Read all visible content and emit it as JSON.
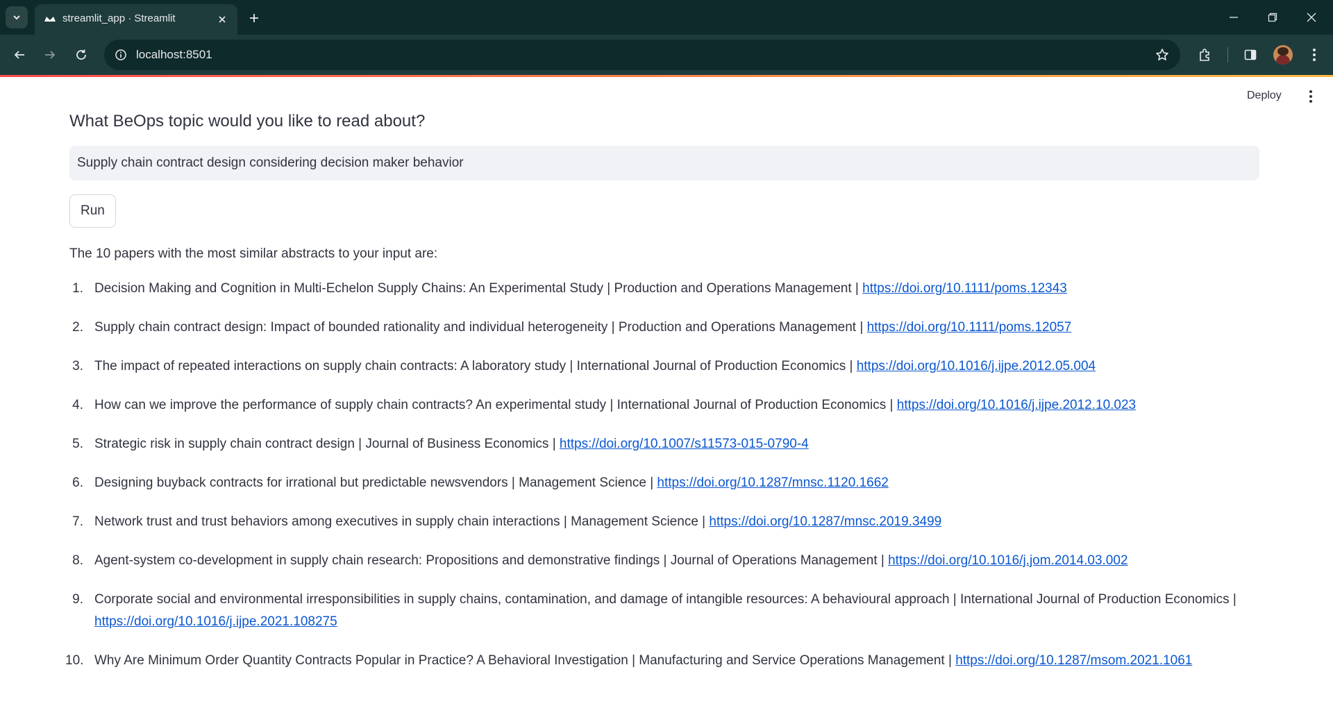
{
  "browser": {
    "tab_title": "streamlit_app · Streamlit",
    "url": "localhost:8501"
  },
  "app": {
    "deploy_label": "Deploy",
    "input_label": "What BeOps topic would you like to read about?",
    "input_value": "Supply chain contract design considering decision maker behavior",
    "run_label": "Run",
    "results_intro": "The 10 papers with the most similar abstracts to your input are:"
  },
  "results": [
    {
      "num": "1.",
      "text": "Decision Making and Cognition in Multi-Echelon Supply Chains: An Experimental Study | Production and Operations Management | ",
      "link": "https://doi.org/10.1111/poms.12343"
    },
    {
      "num": "2.",
      "text": "Supply chain contract design: Impact of bounded rationality and individual heterogeneity | Production and Operations Management | ",
      "link": "https://doi.org/10.1111/poms.12057"
    },
    {
      "num": "3.",
      "text": "The impact of repeated interactions on supply chain contracts: A laboratory study | International Journal of Production Economics | ",
      "link": "https://doi.org/10.1016/j.ijpe.2012.05.004"
    },
    {
      "num": "4.",
      "text": "How can we improve the performance of supply chain contracts? An experimental study | International Journal of Production Economics | ",
      "link": "https://doi.org/10.1016/j.ijpe.2012.10.023"
    },
    {
      "num": "5.",
      "text": "Strategic risk in supply chain contract design | Journal of Business Economics | ",
      "link": "https://doi.org/10.1007/s11573-015-0790-4"
    },
    {
      "num": "6.",
      "text": "Designing buyback contracts for irrational but predictable newsvendors | Management Science | ",
      "link": "https://doi.org/10.1287/mnsc.1120.1662"
    },
    {
      "num": "7.",
      "text": "Network trust and trust behaviors among executives in supply chain interactions | Management Science | ",
      "link": "https://doi.org/10.1287/mnsc.2019.3499"
    },
    {
      "num": "8.",
      "text": "Agent-system co-development in supply chain research: Propositions and demonstrative findings | Journal of Operations Management | ",
      "link": "https://doi.org/10.1016/j.jom.2014.03.002"
    },
    {
      "num": "9.",
      "text": "Corporate social and environmental irresponsibilities in supply chains, contamination, and damage of intangible resources: A behavioural approach | International Journal of Production Economics | ",
      "link": "https://doi.org/10.1016/j.ijpe.2021.108275"
    },
    {
      "num": "10.",
      "text": "Why Are Minimum Order Quantity Contracts Popular in Practice? A Behavioral Investigation | Manufacturing and Service Operations Management | ",
      "link": "https://doi.org/10.1287/msom.2021.1061"
    }
  ],
  "colors": {
    "chrome_dark": "#0e2a2a",
    "chrome_toolbar": "#1f3c3c",
    "link": "#0b57d0",
    "text": "#31333f",
    "input_bg": "#f0f2f6",
    "accent_red": "#ff4b4b"
  },
  "icons": [
    "chevron-down-icon",
    "streamlit-favicon",
    "close-icon",
    "plus-icon",
    "minimize-icon",
    "restore-icon",
    "close-window-icon",
    "back-icon",
    "forward-icon",
    "reload-icon",
    "info-icon",
    "star-icon",
    "extensions-icon",
    "side-panel-icon",
    "kebab-menu-icon"
  ]
}
